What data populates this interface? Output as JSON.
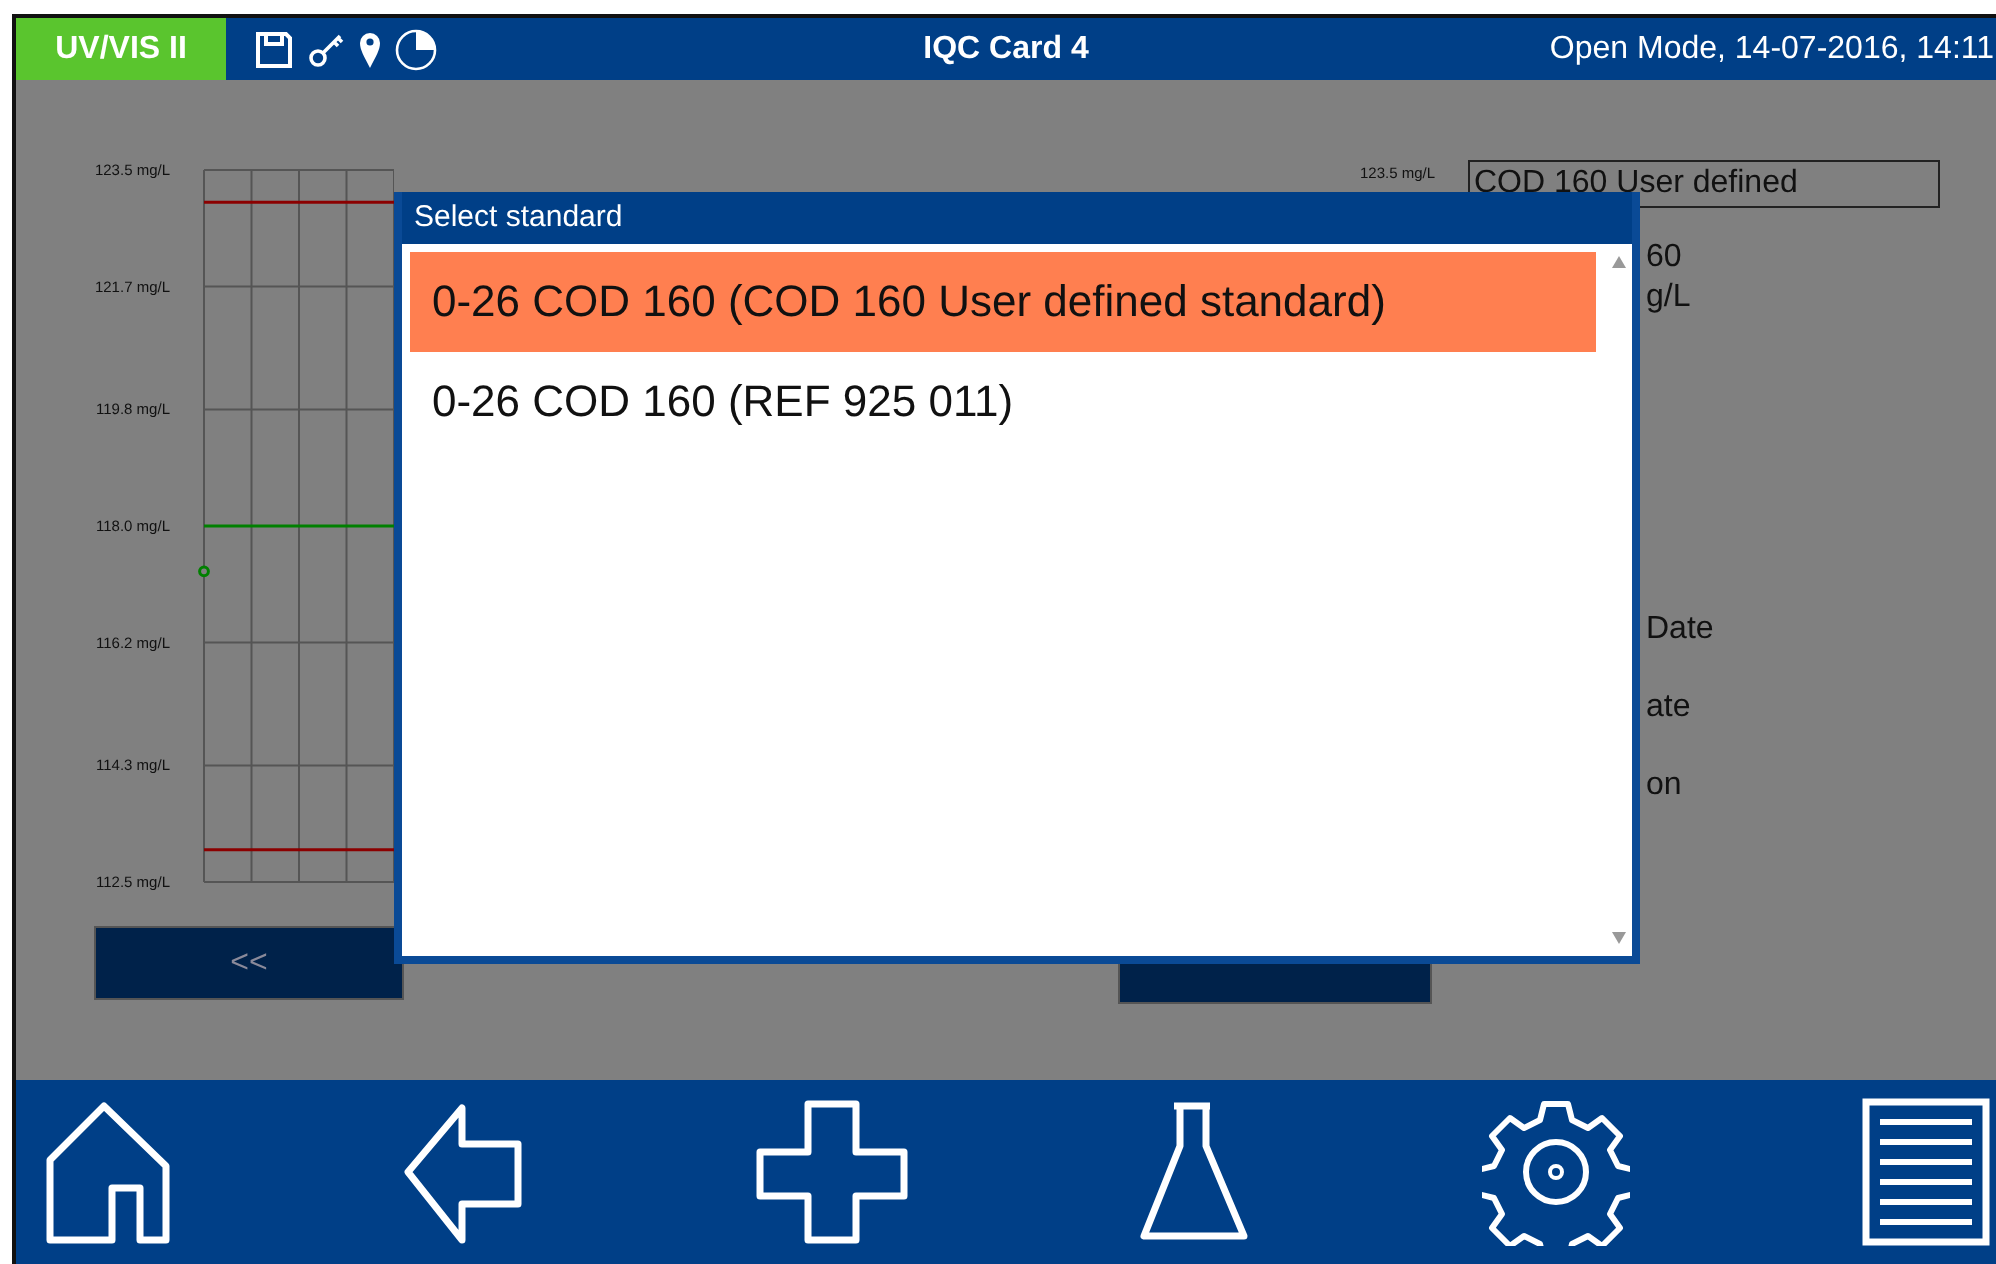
{
  "header": {
    "device": "UV/VIS II",
    "title": "IQC Card 4",
    "status": "Open Mode, 14-07-2016, 14:11"
  },
  "chart": {
    "right_axis_label": "123.5 mg/L",
    "chart_data": {
      "type": "line",
      "grid": true,
      "ylim": [
        112.5,
        123.5
      ],
      "yticks": [
        {
          "value": 123.5,
          "label": "123.5 mg/L"
        },
        {
          "value": 121.7,
          "label": "121.7 mg/L"
        },
        {
          "value": 119.8,
          "label": "119.8 mg/L"
        },
        {
          "value": 118.0,
          "label": "118.0 mg/L"
        },
        {
          "value": 116.2,
          "label": "116.2 mg/L"
        },
        {
          "value": 114.3,
          "label": "114.3 mg/L"
        },
        {
          "value": 112.5,
          "label": "112.5 mg/L"
        }
      ],
      "series": [
        {
          "color": "#8b0000",
          "values": [
            123.0,
            123.0,
            123.0,
            123.0
          ]
        },
        {
          "color": "#008000",
          "values": [
            118.0,
            118.0,
            118.0,
            118.0
          ]
        },
        {
          "color": "#8b0000",
          "values": [
            113.0,
            113.0,
            113.0,
            113.0
          ]
        },
        {
          "color": "#008000",
          "marker": "circle",
          "values": [
            117.3,
            null,
            null,
            null
          ]
        }
      ]
    }
  },
  "back_button": {
    "label": "<<"
  },
  "reference_field": {
    "value": "COD 160 User defined"
  },
  "partial_labels": [
    "60",
    "g/L",
    "Date",
    "ate",
    "on"
  ],
  "dialog": {
    "title": "Select standard",
    "items": [
      {
        "label": "0-26 COD 160 (COD 160 User defined standard)",
        "selected": true
      },
      {
        "label": "0-26 COD 160 (REF 925 011)",
        "selected": false
      }
    ]
  }
}
